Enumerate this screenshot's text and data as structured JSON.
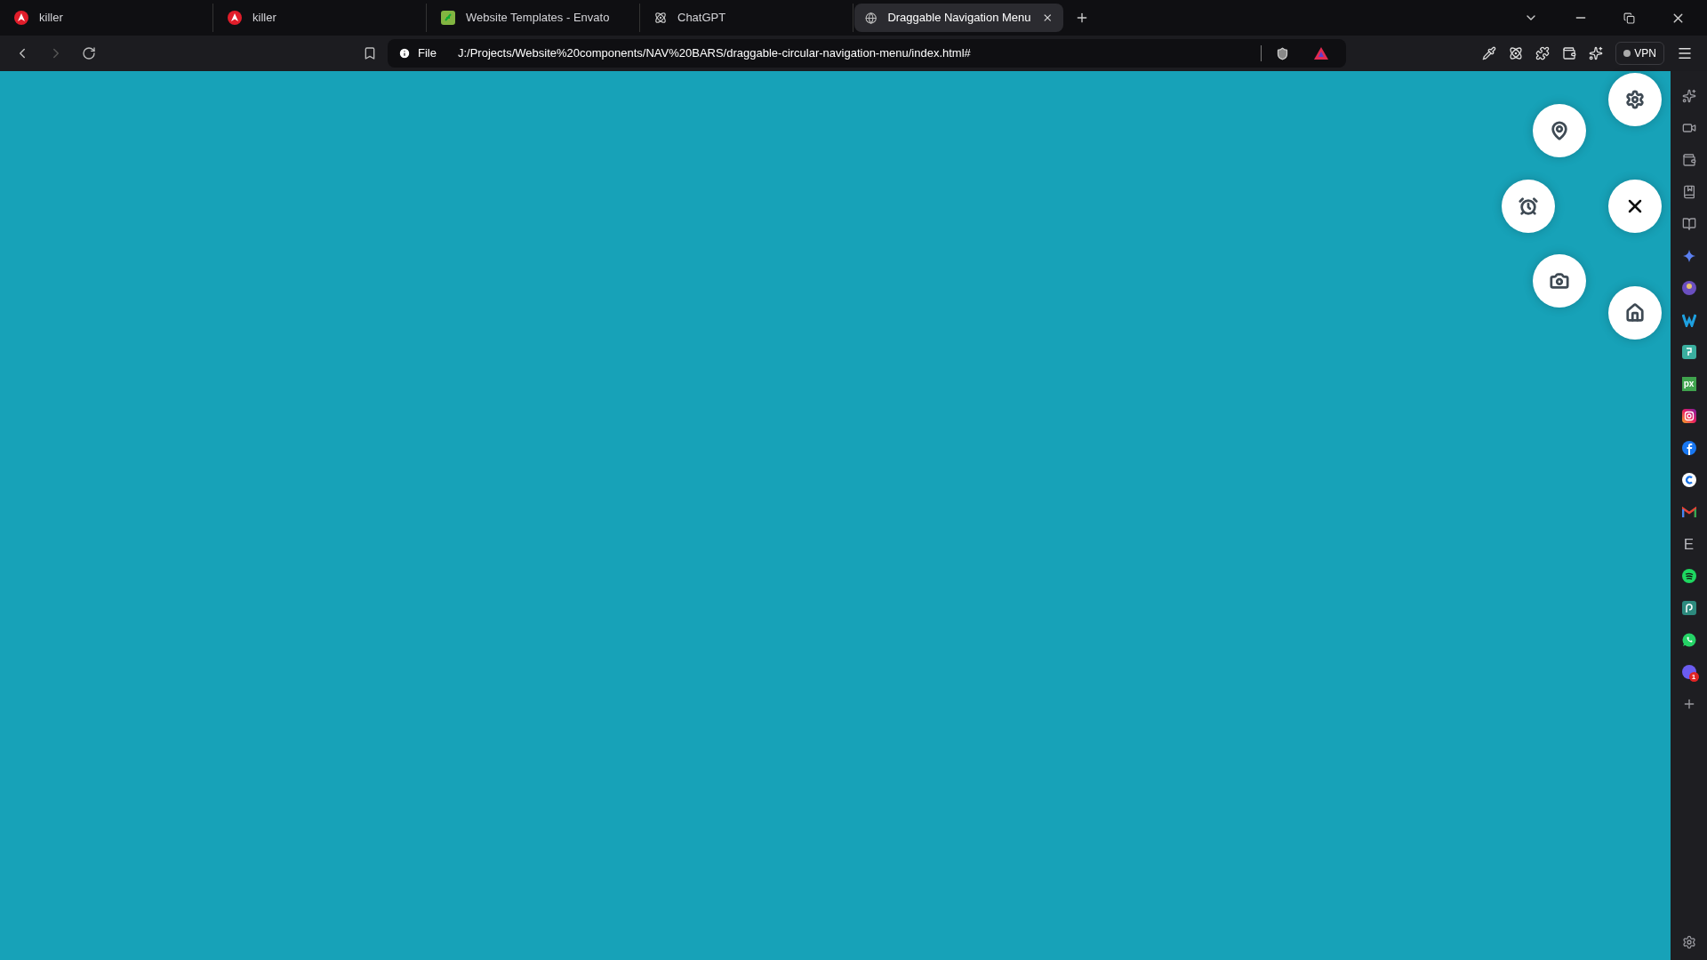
{
  "tabs": [
    {
      "title": "killer",
      "selected": false,
      "kind": "red-logo"
    },
    {
      "title": "killer",
      "selected": false,
      "kind": "red-logo"
    },
    {
      "title": "Website Templates - Envato",
      "selected": false,
      "kind": "envato"
    },
    {
      "title": "ChatGPT",
      "selected": false,
      "kind": "chatgpt"
    },
    {
      "title": "Draggable Navigation Menu",
      "selected": true,
      "kind": "globe"
    }
  ],
  "address_bar": {
    "scheme": "File",
    "url": "J:/Projects/Website%20components/NAV%20BARS/draggable-circular-navigation-menu/index.html#"
  },
  "vpn": {
    "label": "VPN"
  },
  "sidebar": [
    {
      "kind": "sparkle"
    },
    {
      "kind": "video"
    },
    {
      "kind": "wallet"
    },
    {
      "kind": "bookmarks"
    },
    {
      "kind": "reader"
    },
    {
      "kind": "star4"
    },
    {
      "kind": "avatar"
    },
    {
      "kind": "w-logo"
    },
    {
      "kind": "doc-logo"
    },
    {
      "kind": "glyph",
      "text": "px",
      "color": "#3fa34d"
    },
    {
      "kind": "instagram"
    },
    {
      "kind": "facebook"
    },
    {
      "kind": "c-logo"
    },
    {
      "kind": "gmail"
    },
    {
      "kind": "letter",
      "text": "E"
    },
    {
      "kind": "spotify"
    },
    {
      "kind": "swirl"
    },
    {
      "kind": "whatsapp"
    },
    {
      "kind": "messenger",
      "badge": "1"
    },
    {
      "kind": "plus"
    }
  ],
  "nav_menu": [
    {
      "kind": "settings"
    },
    {
      "kind": "location"
    },
    {
      "kind": "alarm"
    },
    {
      "kind": "close"
    },
    {
      "kind": "camera"
    },
    {
      "kind": "home"
    }
  ]
}
